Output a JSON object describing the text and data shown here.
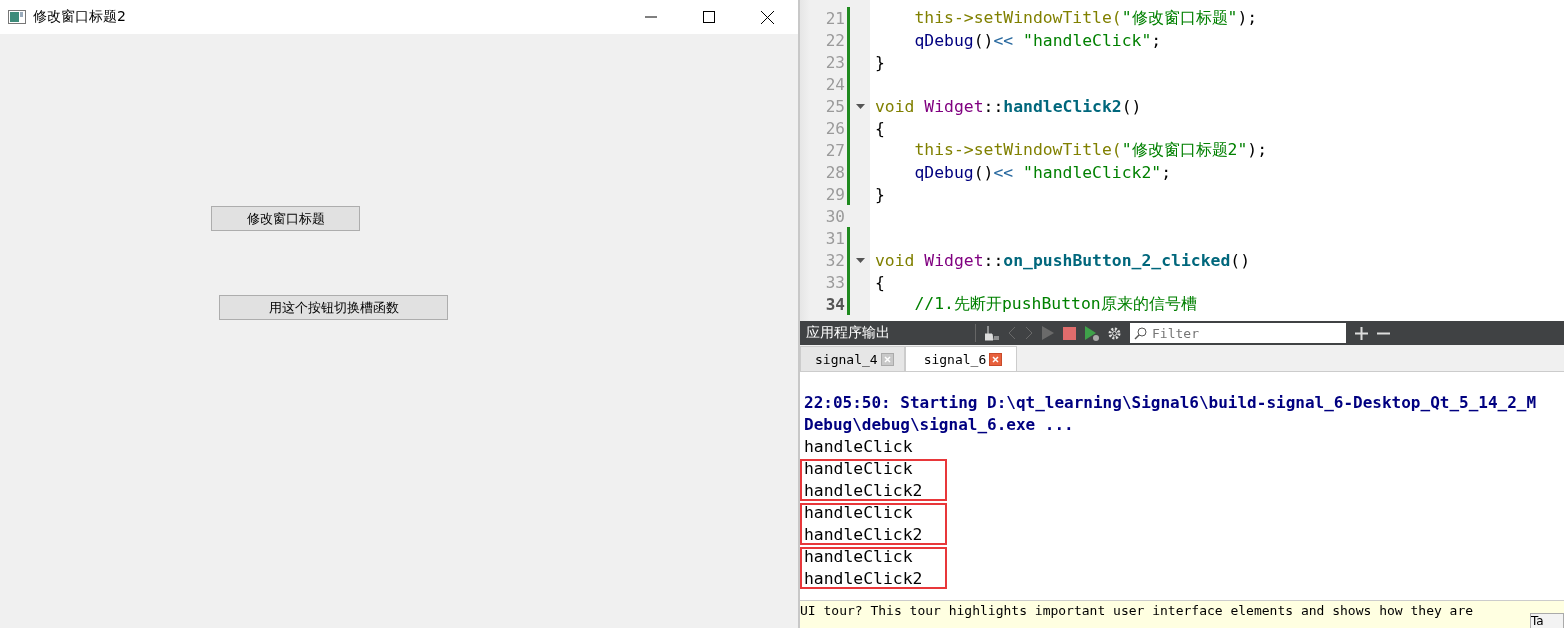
{
  "app_window": {
    "title": "修改窗口标题2",
    "buttons": [
      "修改窗口标题",
      "用这个按钮切换槽函数"
    ]
  },
  "editor": {
    "lines": [
      {
        "number": "21",
        "current": false,
        "changed": true,
        "foldable": false,
        "tokens": [
          {
            "t": "    this->setWindowTitle(",
            "kind": "kw"
          },
          {
            "t": "\"修改窗口标题\"",
            "kind": "str"
          },
          {
            "t": ");",
            "kind": "plain"
          }
        ]
      },
      {
        "number": "22",
        "current": false,
        "changed": true,
        "foldable": false,
        "tokens": [
          {
            "t": "    qDebug",
            "kind": "call"
          },
          {
            "t": "()",
            "kind": "plain"
          },
          {
            "t": "<< ",
            "kind": "op"
          },
          {
            "t": "\"handleClick\"",
            "kind": "str"
          },
          {
            "t": ";",
            "kind": "plain"
          }
        ]
      },
      {
        "number": "23",
        "current": false,
        "changed": true,
        "foldable": false,
        "tokens": [
          {
            "t": "}",
            "kind": "plain"
          }
        ]
      },
      {
        "number": "24",
        "current": false,
        "changed": true,
        "foldable": false
      },
      {
        "number": "25",
        "current": false,
        "changed": true,
        "foldable": true,
        "tokens": [
          {
            "t": "void ",
            "kind": "kw"
          },
          {
            "t": "Widget",
            "kind": "type"
          },
          {
            "t": "::",
            "kind": "plain"
          },
          {
            "t": "handleClick2",
            "kind": "func"
          },
          {
            "t": "()",
            "kind": "plain"
          }
        ]
      },
      {
        "number": "26",
        "current": false,
        "changed": true,
        "foldable": false,
        "tokens": [
          {
            "t": "{",
            "kind": "plain"
          }
        ]
      },
      {
        "number": "27",
        "current": false,
        "changed": true,
        "foldable": false,
        "tokens": [
          {
            "t": "    this->setWindowTitle(",
            "kind": "kw"
          },
          {
            "t": "\"修改窗口标题2\"",
            "kind": "str"
          },
          {
            "t": ");",
            "kind": "plain"
          }
        ]
      },
      {
        "number": "28",
        "current": false,
        "changed": true,
        "foldable": false,
        "tokens": [
          {
            "t": "    qDebug",
            "kind": "call"
          },
          {
            "t": "()",
            "kind": "plain"
          },
          {
            "t": "<< ",
            "kind": "op"
          },
          {
            "t": "\"handleClick2\"",
            "kind": "str"
          },
          {
            "t": ";",
            "kind": "plain"
          }
        ]
      },
      {
        "number": "29",
        "current": false,
        "changed": true,
        "foldable": false,
        "tokens": [
          {
            "t": "}",
            "kind": "plain"
          }
        ]
      },
      {
        "number": "30",
        "current": false,
        "changed": false,
        "foldable": false
      },
      {
        "number": "31",
        "current": false,
        "changed": true,
        "foldable": false
      },
      {
        "number": "32",
        "current": false,
        "changed": true,
        "foldable": true,
        "tokens": [
          {
            "t": "void ",
            "kind": "kw"
          },
          {
            "t": "Widget",
            "kind": "type"
          },
          {
            "t": "::",
            "kind": "plain"
          },
          {
            "t": "on_pushButton_2_clicked",
            "kind": "func"
          },
          {
            "t": "()",
            "kind": "plain"
          }
        ]
      },
      {
        "number": "33",
        "current": false,
        "changed": true,
        "foldable": false,
        "tokens": [
          {
            "t": "{",
            "kind": "plain"
          }
        ]
      },
      {
        "number": "34",
        "current": true,
        "changed": true,
        "foldable": false,
        "tokens": [
          {
            "t": "    //1.先断开pushButton原来的信号槽",
            "kind": "comment"
          }
        ]
      }
    ]
  },
  "output_pane": {
    "title": "应用程序输出",
    "filter": {
      "placeholder": "Filter"
    },
    "tabs": [
      {
        "label": "signal_4",
        "selected": false
      },
      {
        "label": "signal_6",
        "selected": true
      }
    ],
    "blocks": [
      {
        "boxed": false,
        "lines": [
          {
            "text": "22:05:50: Starting D:\\qt_learning\\Signal6\\build-signal_6-Desktop_Qt_5_14_2_M",
            "kind": "status"
          },
          {
            "text": "Debug\\debug\\signal_6.exe ...",
            "kind": "status"
          },
          {
            "text": "handleClick",
            "kind": "stdout"
          }
        ]
      },
      {
        "boxed": true,
        "lines": [
          {
            "text": "handleClick",
            "kind": "stdout"
          },
          {
            "text": "handleClick2",
            "kind": "stdout"
          }
        ]
      },
      {
        "boxed": true,
        "lines": [
          {
            "text": "handleClick",
            "kind": "stdout"
          },
          {
            "text": "handleClick2",
            "kind": "stdout"
          }
        ]
      },
      {
        "boxed": true,
        "lines": [
          {
            "text": "handleClick",
            "kind": "stdout"
          },
          {
            "text": "handleClick2",
            "kind": "stdout"
          }
        ]
      }
    ]
  },
  "notice": {
    "text": "UI tour? This tour highlights important user interface elements and shows how they are",
    "button": "Ta"
  }
}
